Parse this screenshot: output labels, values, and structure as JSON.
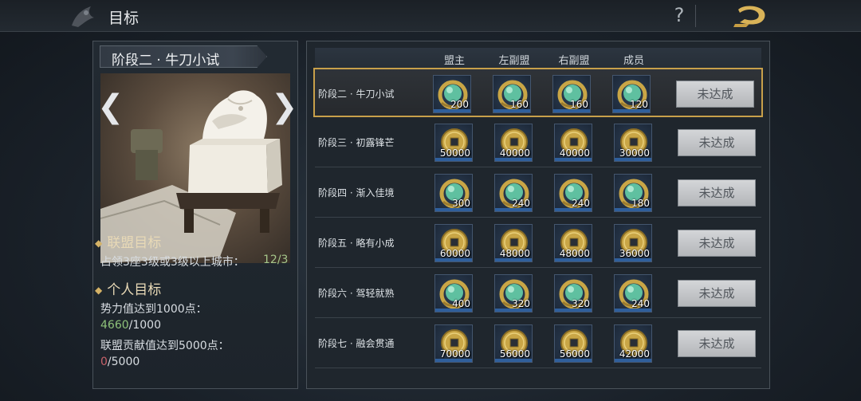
{
  "header": {
    "title": "目标",
    "help_label": "?"
  },
  "left": {
    "stage_title": "阶段二 · 牛刀小试",
    "prev_arrow": "❮",
    "next_arrow": "❯",
    "alliance_goal": {
      "heading": "联盟目标",
      "text": "占领3座3级或3级以上城市：",
      "progress": "12/3"
    },
    "personal_goal": {
      "heading": "个人目标",
      "power_text": "势力值达到1000点：",
      "power_current": "4660",
      "power_target": "/1000",
      "contrib_text": "联盟贡献值达到5000点：",
      "contrib_current": "0",
      "contrib_target": "/5000"
    }
  },
  "table": {
    "columns": [
      "盟主",
      "左副盟",
      "右副盟",
      "成员"
    ],
    "rows": [
      {
        "stage": "阶段二 · 牛刀小试",
        "type": "jade",
        "rewards": [
          "200",
          "160",
          "160",
          "120"
        ],
        "status": "未达成",
        "active": true
      },
      {
        "stage": "阶段三 · 初露锋芒",
        "type": "coin",
        "rewards": [
          "50000",
          "40000",
          "40000",
          "30000"
        ],
        "status": "未达成",
        "active": false
      },
      {
        "stage": "阶段四 · 渐入佳境",
        "type": "jade",
        "rewards": [
          "300",
          "240",
          "240",
          "180"
        ],
        "status": "未达成",
        "active": false
      },
      {
        "stage": "阶段五 · 略有小成",
        "type": "coin",
        "rewards": [
          "60000",
          "48000",
          "48000",
          "36000"
        ],
        "status": "未达成",
        "active": false
      },
      {
        "stage": "阶段六 · 驾轻就熟",
        "type": "jade",
        "rewards": [
          "400",
          "320",
          "320",
          "240"
        ],
        "status": "未达成",
        "active": false
      },
      {
        "stage": "阶段七 · 融会贯通",
        "type": "coin",
        "rewards": [
          "70000",
          "56000",
          "56000",
          "42000"
        ],
        "status": "未达成",
        "active": false
      }
    ]
  },
  "colors": {
    "accent_gold": "#c8a04a",
    "progress_green": "#8ec27a",
    "progress_red": "#c7626b"
  }
}
